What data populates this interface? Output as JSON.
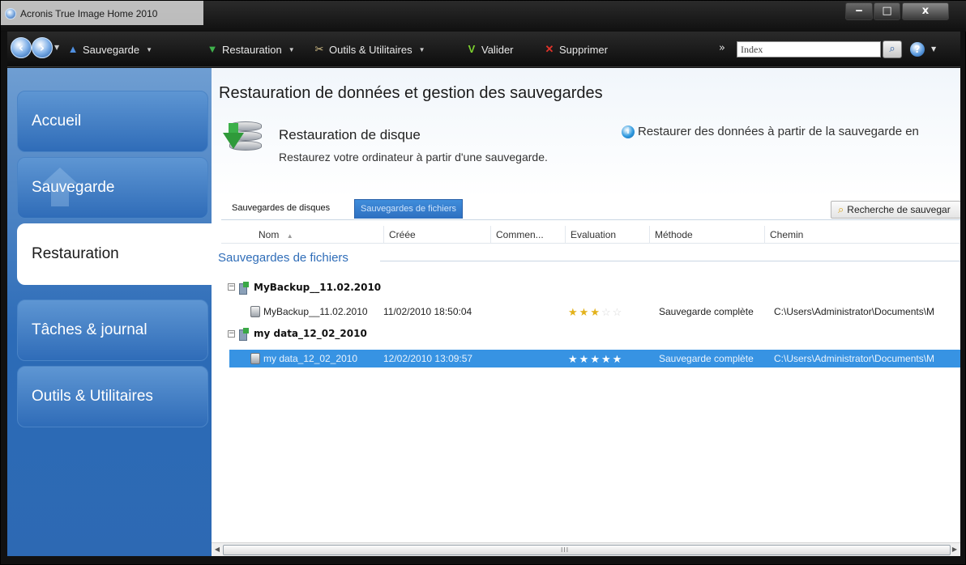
{
  "window": {
    "title": "Acronis True Image Home 2010",
    "controls": {
      "minimize": "‒",
      "maximize": "□",
      "close": "x"
    }
  },
  "toolbar": {
    "backup": "Sauvegarde",
    "restore": "Restauration",
    "tools": "Outils & Utilitaires",
    "validate": "Valider",
    "delete": "Supprimer",
    "more": "»",
    "search_value": "Index"
  },
  "sidebar": {
    "items": [
      {
        "label": "Accueil",
        "active": false
      },
      {
        "label": "Sauvegarde",
        "active": false
      },
      {
        "label": "Restauration",
        "active": true
      },
      {
        "label": "Tâches & journal",
        "active": false
      },
      {
        "label": "Outils & Utilitaires",
        "active": false
      }
    ]
  },
  "main": {
    "page_title": "Restauration de données et gestion des sauvegardes",
    "section_title": "Restauration de disque",
    "section_subtitle": "Restaurez votre ordinateur à partir d'une sauvegarde.",
    "info_link": "Restaurer des données à partir de la sauvegarde en",
    "tabs": [
      {
        "label": "Sauvegardes de disques",
        "active": false
      },
      {
        "label": "Sauvegardes de fichiers",
        "active": true
      }
    ],
    "find_button": "Recherche de sauvegar",
    "columns": [
      "Nom",
      "Créée",
      "Commen...",
      "Evaluation",
      "Méthode",
      "Chemin"
    ],
    "group_title": "Sauvegardes de fichiers",
    "groups": [
      {
        "name": "MyBackup__11.02.2010",
        "item": {
          "name": "MyBackup__11.02.2010",
          "created": "11/02/2010 18:50:04",
          "rating": 3,
          "method": "Sauvegarde complète",
          "path": "C:\\Users\\Administrator\\Documents\\M",
          "selected": false
        }
      },
      {
        "name": "my data_12_02_2010",
        "item": {
          "name": "my data_12_02_2010",
          "created": "12/02/2010 13:09:57",
          "rating": 5,
          "method": "Sauvegarde complète",
          "path": "C:\\Users\\Administrator\\Documents\\M",
          "selected": true
        }
      }
    ]
  },
  "scrollbar": {
    "grip": "III"
  },
  "colors": {
    "accent": "#3793e3",
    "sidebar": "#2c6bb7",
    "title_bar": "#101010",
    "star": "#e3b21b"
  },
  "icons": [
    "back-icon",
    "forward-icon",
    "backup-icon",
    "restore-icon",
    "tools-icon",
    "validate-icon",
    "delete-icon",
    "search-icon",
    "help-icon",
    "disk-restore-icon",
    "info-icon",
    "find-icon",
    "backup-folder-icon",
    "file-icon"
  ]
}
